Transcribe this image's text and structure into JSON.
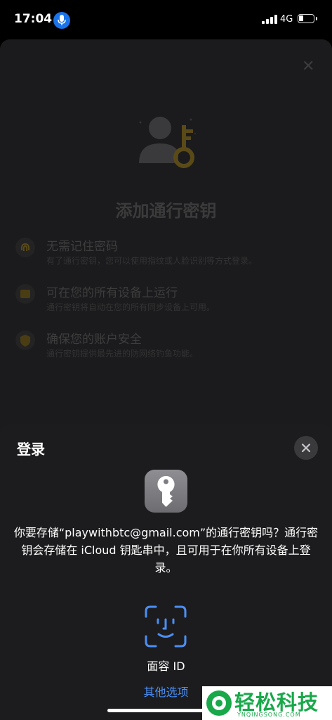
{
  "status_bar": {
    "time": "17:04",
    "network": "4G",
    "mic_icon": "microphone-icon",
    "battery_level": 0.3
  },
  "background_card": {
    "title": "添加通行密钥",
    "features": [
      {
        "icon": "fingerprint-icon",
        "title": "无需记住密码",
        "subtitle": "有了通行密钥，您可以使用指纹或人脸识别等方式登录。"
      },
      {
        "icon": "devices-icon",
        "title": "可在您的所有设备上运行",
        "subtitle": "通行密钥将自动在您的所有同步设备上可用。"
      },
      {
        "icon": "shield-icon",
        "title": "确保您的账户安全",
        "subtitle": "通行密钥提供最先进的防网络钓鱼功能。"
      }
    ]
  },
  "sheet": {
    "title": "登录",
    "message": "你要存储“playwithbtc@gmail.com”的通行密钥吗？通行密钥会存储在 iCloud 钥匙串中，且可用于在你所有设备上登录。",
    "face_id_label": "面容 ID",
    "other_options": "其他选项"
  },
  "watermark": {
    "text": "轻松科技",
    "sub": "YNQINGSONG.COM"
  },
  "colors": {
    "accent": "#4a8ff7",
    "sheet_bg": "#1c1c1e",
    "gold": "#c9a227"
  }
}
